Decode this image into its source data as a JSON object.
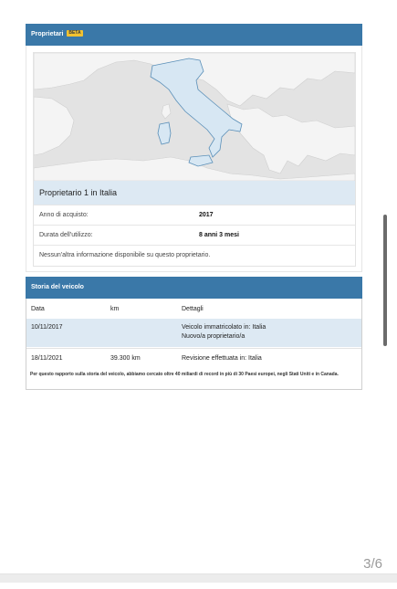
{
  "owners_section": {
    "title": "Proprietari",
    "badge": "BETA",
    "map_label": "Italia",
    "owner_title": "Proprietario 1 in Italia",
    "rows": [
      {
        "label": "Anno di acquisto:",
        "value": "2017"
      },
      {
        "label": "Durata dell'utilizzo:",
        "value": "8 anni 3 mesi"
      }
    ],
    "note": "Nessun'altra informazione disponibile su questo proprietario."
  },
  "history_section": {
    "title": "Storia del veicolo",
    "columns": [
      "Data",
      "km",
      "Dettagli"
    ],
    "rows": [
      {
        "date": "10/11/2017",
        "km": "",
        "details": [
          "Veicolo immatricolato in: Italia",
          "Nuovo/a proprietario/a"
        ]
      },
      {
        "date": "18/11/2021",
        "km": "39.300 km",
        "details": [
          "Revisione effettuata in: Italia"
        ]
      }
    ],
    "footnote": "Per questo rapporto sulla storia del veicolo, abbiamo cercato oltre 40 miliardi di record in più di 30 Paesi europei, negli Stati Uniti e in Canada."
  },
  "pager": "3/6",
  "colors": {
    "header": "#3a78a8",
    "highlight_row": "#dde9f3",
    "badge": "#f2c230",
    "map_land": "#f4f4f4",
    "map_sea": "#e3e3e3",
    "italy": "#d7e7f3"
  }
}
